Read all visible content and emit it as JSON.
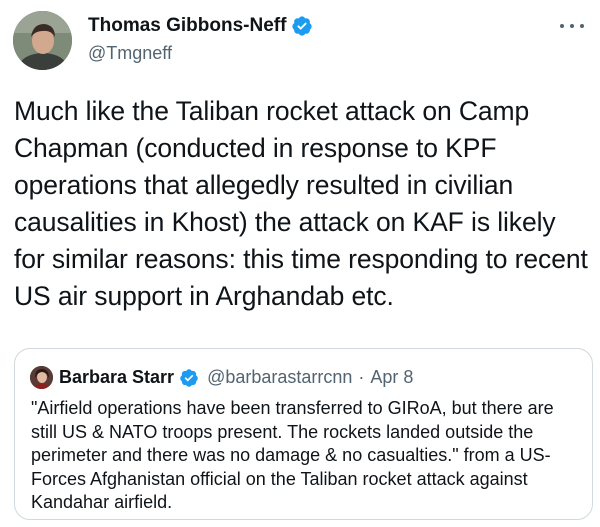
{
  "author": {
    "display_name": "Thomas Gibbons-Neff",
    "handle": "@Tmgneff",
    "avatar_icon": "profile-photo",
    "verified_icon": "verified-badge-icon"
  },
  "tweet": {
    "text": "Much like the Taliban rocket attack on Camp Chapman (conducted in response to KPF operations that allegedly resulted in civilian causalities in Khost) the attack on KAF is likely for similar reasons: this time responding to recent US air support in Arghandab etc."
  },
  "quoted_tweet": {
    "display_name": "Barbara Starr",
    "handle": "@barbarastarrcnn",
    "separator": "·",
    "date": "Apr 8",
    "text": "\"Airfield operations have been transferred to GIRoA, but there are still US & NATO troops present.  The rockets landed outside the perimeter and there was no damage & no casualties.\" from a US-Forces Afghanistan official on the Taliban rocket attack against Kandahar airfield."
  },
  "colors": {
    "verified": "#1d9bf0",
    "secondary_text": "#536471",
    "border": "#cfd9de"
  }
}
